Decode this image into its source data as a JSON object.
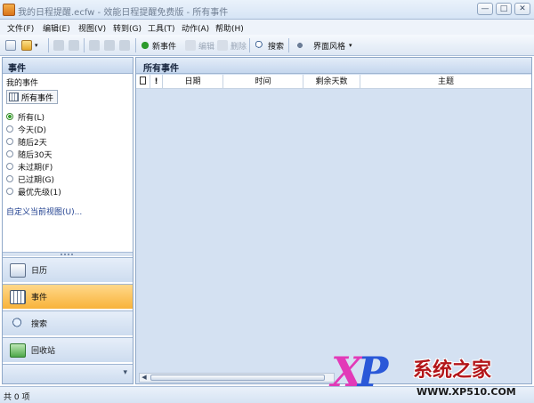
{
  "window": {
    "title": "我的日程提醒.ecfw - 效能日程提醒免费版 - 所有事件",
    "controls": {
      "minimize": "—",
      "maximize": "□",
      "close": "✕"
    }
  },
  "menu": [
    {
      "label": "文件(F)"
    },
    {
      "label": "编辑(E)"
    },
    {
      "label": "视图(V)"
    },
    {
      "label": "转到(G)"
    },
    {
      "label": "工具(T)"
    },
    {
      "label": "动作(A)"
    },
    {
      "label": "帮助(H)"
    }
  ],
  "toolbar": {
    "new_event": "新事件",
    "edit": "编辑",
    "delete": "删除",
    "search": "搜索",
    "style": "界面风格"
  },
  "left_panel": {
    "title": "事件",
    "my_events_label": "我的事件",
    "all_events_button": "所有事件",
    "filters": [
      {
        "label": "所有(L)",
        "checked": true
      },
      {
        "label": "今天(D)",
        "checked": false
      },
      {
        "label": "随后2天",
        "checked": false
      },
      {
        "label": "随后30天",
        "checked": false
      },
      {
        "label": "未过期(F)",
        "checked": false
      },
      {
        "label": "已过期(G)",
        "checked": false
      },
      {
        "label": "最优先级(1)",
        "checked": false
      }
    ],
    "custom_view_link": "自定义当前视图(U)...",
    "nav": [
      {
        "label": "日历",
        "icon": "calendar-icon",
        "active": false
      },
      {
        "label": "事件",
        "icon": "events-icon",
        "active": true
      },
      {
        "label": "搜索",
        "icon": "search-icon",
        "active": false
      },
      {
        "label": "回收站",
        "icon": "recycle-bin-icon",
        "active": false
      }
    ]
  },
  "right_panel": {
    "title": "所有事件",
    "columns": [
      "日期",
      "时间",
      "剩余天数",
      "主题"
    ]
  },
  "status": {
    "text": "共 0 项"
  },
  "watermark": {
    "logo_text": "XP",
    "brand": "系统之家",
    "url": "WWW.XP510.COM"
  }
}
